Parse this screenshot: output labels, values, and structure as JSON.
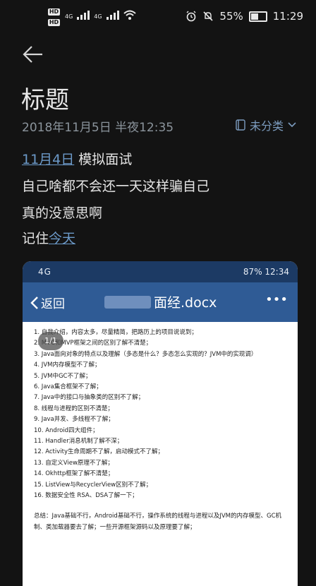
{
  "status_bar": {
    "hd1": "HD",
    "hd2": "HD",
    "net1": "4G",
    "net2": "4G",
    "battery_percent": "55%",
    "battery_level": 0.55,
    "time": "11:29"
  },
  "note": {
    "title": "标题",
    "date": "2018年11月5日 半夜12:35",
    "category": "未分类",
    "lines": [
      {
        "link": "11月4日",
        "text": " 模拟面试"
      },
      {
        "text": "自己啥都不会还一天这样骗自己"
      },
      {
        "text": "真的没意思啊"
      },
      {
        "prefix": "记住",
        "link": "今天"
      }
    ]
  },
  "embedded": {
    "status_left": "4G",
    "status_right": "87%  12:34",
    "back_label": "返回",
    "doc_title": "面经.docx",
    "menu": "•••",
    "page_indicator": "1/1",
    "items": [
      "1.   自我介绍，内容太多，尽量精简，把路历上的项目说说到；",
      "2.   MVC和MVP框架之间的区别了解不清楚；",
      "3.   Java面向对象的特点以及理解（多态是什么？多态怎么实现的？JVM中的实现调）",
      "4.   JVM内存模型不了解；",
      "5.   JVM中GC不了解；",
      "6.   Java集合框架不了解；",
      "7.   Java中的接口与抽象类的区别不了解；",
      "8.   线程与进程的区别不清楚；",
      "9.   Java并发、多线程不了解；",
      "10. Android四大组件；",
      "11. Handler消息机制了解不深；",
      "12. Activity生命周期不了解，启动模式不了解；",
      "13. 自定义View原理不了解；",
      "14. Okhttp框架了解不清楚；",
      "15. ListView与RecyclerView区别不了解；",
      "16. 数据安全性 RSA、DSA了解一下；"
    ],
    "summary": "总结：Java基础不行，Android基础不行，操作系统的线程与进程以及JVM的内存模型、GC机制、类加载器要去了解；一些开源框架源码以及原理要了解；"
  }
}
